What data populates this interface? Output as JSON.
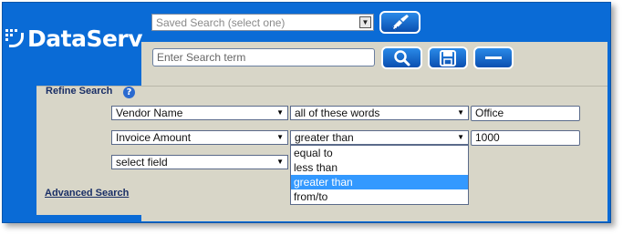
{
  "logo": {
    "text": "DataServ"
  },
  "saved_search": {
    "value": "Saved Search (select one)"
  },
  "search": {
    "placeholder": "Enter Search term"
  },
  "refine": {
    "title": "Refine Search",
    "rows": [
      {
        "field": "Vendor Name",
        "operator": "all of these words",
        "value": "Office"
      },
      {
        "field": "Invoice Amount",
        "operator": "greater than",
        "value": "1000"
      },
      {
        "field": "select field"
      }
    ],
    "operator_options": [
      "equal to",
      "less than",
      "greater than",
      "from/to"
    ],
    "selected_option": "greater than"
  },
  "advanced_search_label": "Advanced Search",
  "colors": {
    "frame_blue": "#0a6bd6",
    "panel_grey": "#d8d6c8",
    "highlight": "#3399ff",
    "label_navy": "#1a2f66"
  },
  "icons": [
    "broom-icon",
    "search-icon",
    "save-icon",
    "minus-icon",
    "help-icon",
    "chevron-down-icon"
  ]
}
